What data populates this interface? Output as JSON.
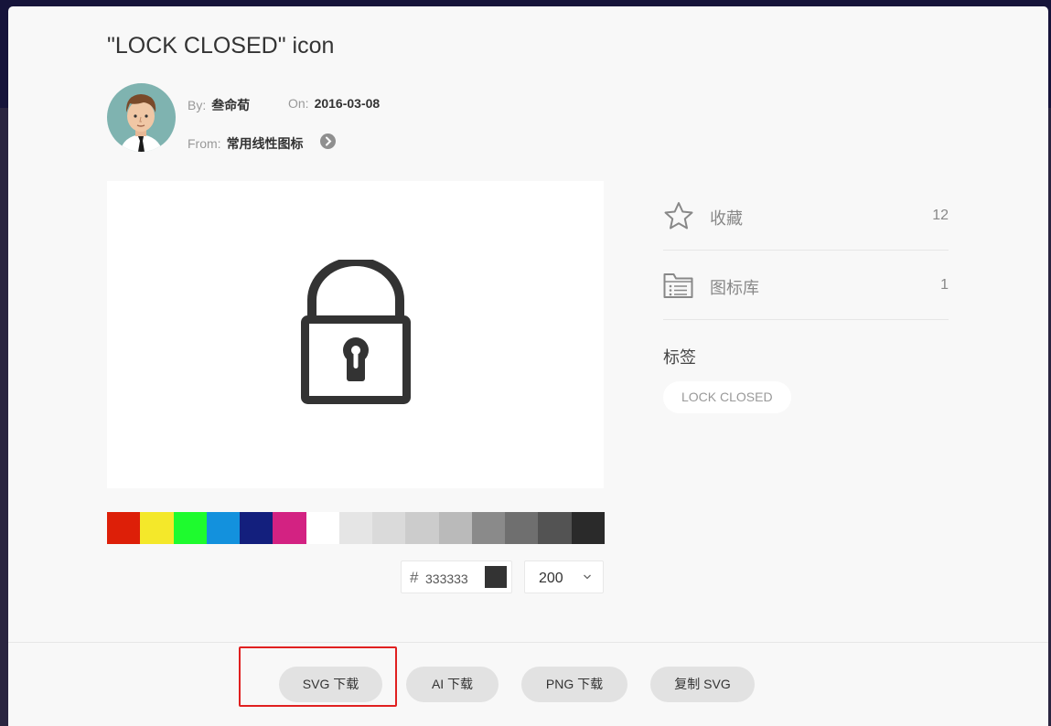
{
  "title": "\"LOCK CLOSED\" icon",
  "meta": {
    "by_label": "By:",
    "author": "叁命荀",
    "on_label": "On:",
    "date": "2016-03-08",
    "from_label": "From:",
    "collection": "常用线性图标"
  },
  "icon": {
    "name": "lock-closed-icon",
    "color": "#333333"
  },
  "palette": [
    "#dd1f08",
    "#f4e82a",
    "#1efb2e",
    "#1391dd",
    "#131f7d",
    "#d32282",
    "#ffffff",
    "#e5e5e5",
    "#dadada",
    "#cccccc",
    "#bababa",
    "#8a8a8a",
    "#6f6f6f",
    "#535353",
    "#2a2a2a"
  ],
  "color_input": {
    "hash": "#",
    "value": "333333"
  },
  "size_select": {
    "value": "200"
  },
  "stats": [
    {
      "icon": "star-icon",
      "label": "收藏",
      "count": "12"
    },
    {
      "icon": "folder-list-icon",
      "label": "图标库",
      "count": "1"
    }
  ],
  "tags_title": "标签",
  "tags": [
    "LOCK CLOSED"
  ],
  "buttons": {
    "svg_download": "SVG 下载",
    "ai_download": "AI 下载",
    "png_download": "PNG 下载",
    "copy_svg": "复制 SVG"
  },
  "highlight_color": "#e02020"
}
